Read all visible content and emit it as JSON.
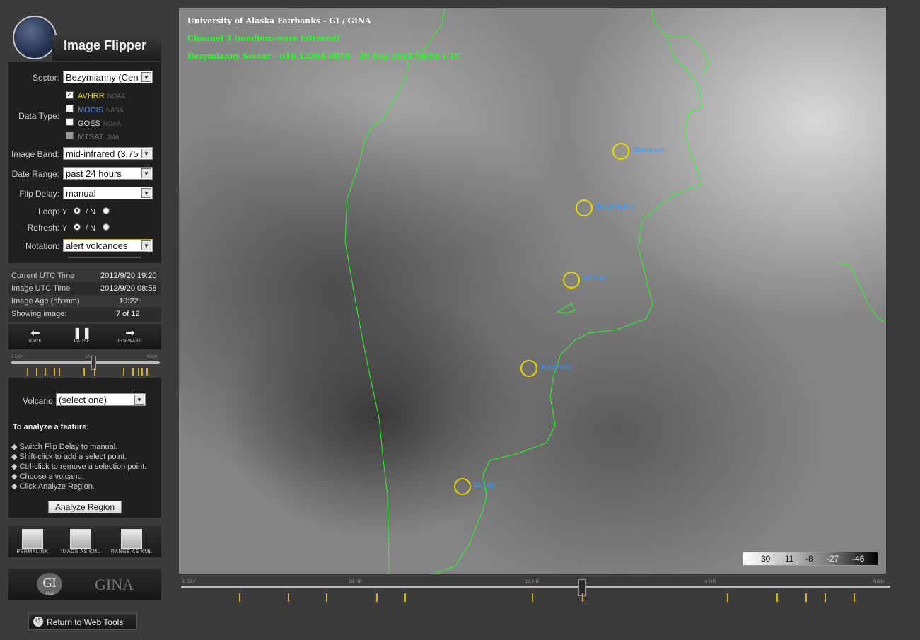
{
  "app": {
    "title": "Image Flipper"
  },
  "controls": {
    "sector_label": "Sector:",
    "sector_value": "Bezymianny (Cen",
    "data_type_label": "Data Type:",
    "data_types": [
      {
        "name": "AVHRR",
        "source": "NOAA",
        "checked": true,
        "color": "#e8d800"
      },
      {
        "name": "MODIS",
        "source": "NASA",
        "checked": false,
        "color": "#4f8fd8"
      },
      {
        "name": "GOES",
        "source": "NOAA",
        "checked": false,
        "color": "#d8d8d8"
      },
      {
        "name": "MTSAT",
        "source": "JMA",
        "checked": false,
        "color": "#777777"
      }
    ],
    "image_band_label": "Image Band:",
    "image_band_value": "mid-infrared (3.75",
    "date_range_label": "Date Range:",
    "date_range_value": "past 24 hours",
    "flip_delay_label": "Flip Delay:",
    "flip_delay_value": "manual",
    "loop_label": "Loop:",
    "refresh_label": "Refresh:",
    "yes": "Y",
    "no": "/ N",
    "notation_label": "Notation:",
    "notation_value": "alert volcanoes"
  },
  "info": {
    "current_utc_label": "Current UTC Time",
    "current_utc_value": "2012/9/20 19:20",
    "image_utc_label": "Image UTC Time",
    "image_utc_value": "2012/9/20 08:58",
    "image_age_label": "Image Age (hh:mm)",
    "image_age_value": "10:22",
    "showing_label": "Showing image:",
    "showing_value": "7 of 12"
  },
  "playback": {
    "back": "BACK",
    "pause": "PAUSE",
    "forward": "FORWARD"
  },
  "mini_timeline": {
    "start": "1 DAY",
    "mid": "12 H",
    "end": "NOW"
  },
  "analyze": {
    "volcano_label": "Volcano:",
    "volcano_value": "(select one)",
    "heading": "To analyze a feature:",
    "steps": [
      "Switch Flip Delay to manual.",
      "Shift-click to add a select point.",
      "Ctrl-click to remove a selection point.",
      "Choose a volcano.",
      "Click Analyze Region."
    ],
    "button": "Analyze Region"
  },
  "kml": {
    "permalink": "PERMALINK",
    "image_kml": "IMAGE AS KML",
    "range_kml": "RANGE AS KML"
  },
  "footer": {
    "gi": "GI",
    "gi_sub": "UAF",
    "gina": "GINA",
    "return": "Return to Web Tools"
  },
  "image": {
    "line1": "University of Alaska Fairbanks - GI / GINA",
    "line2": "Channel 3 (medium-wave infrared)",
    "line3": "Bezymianny Sector - n16.12264.0858 - 20 Sep 2012 08:58 UTC",
    "line1_color": "#ffffff",
    "line2_color": "#22ff22",
    "volcanoes": [
      "Shiveluch",
      "Bezymianny",
      "Kizimen",
      "Karymsky",
      "Gorely"
    ],
    "colorbar": [
      "30",
      "11",
      "-8",
      "-27",
      "-46"
    ]
  },
  "main_timeline": {
    "labels": [
      "1 DAY",
      "18 HR",
      "12 HR",
      "6 HR",
      "NOW"
    ]
  }
}
